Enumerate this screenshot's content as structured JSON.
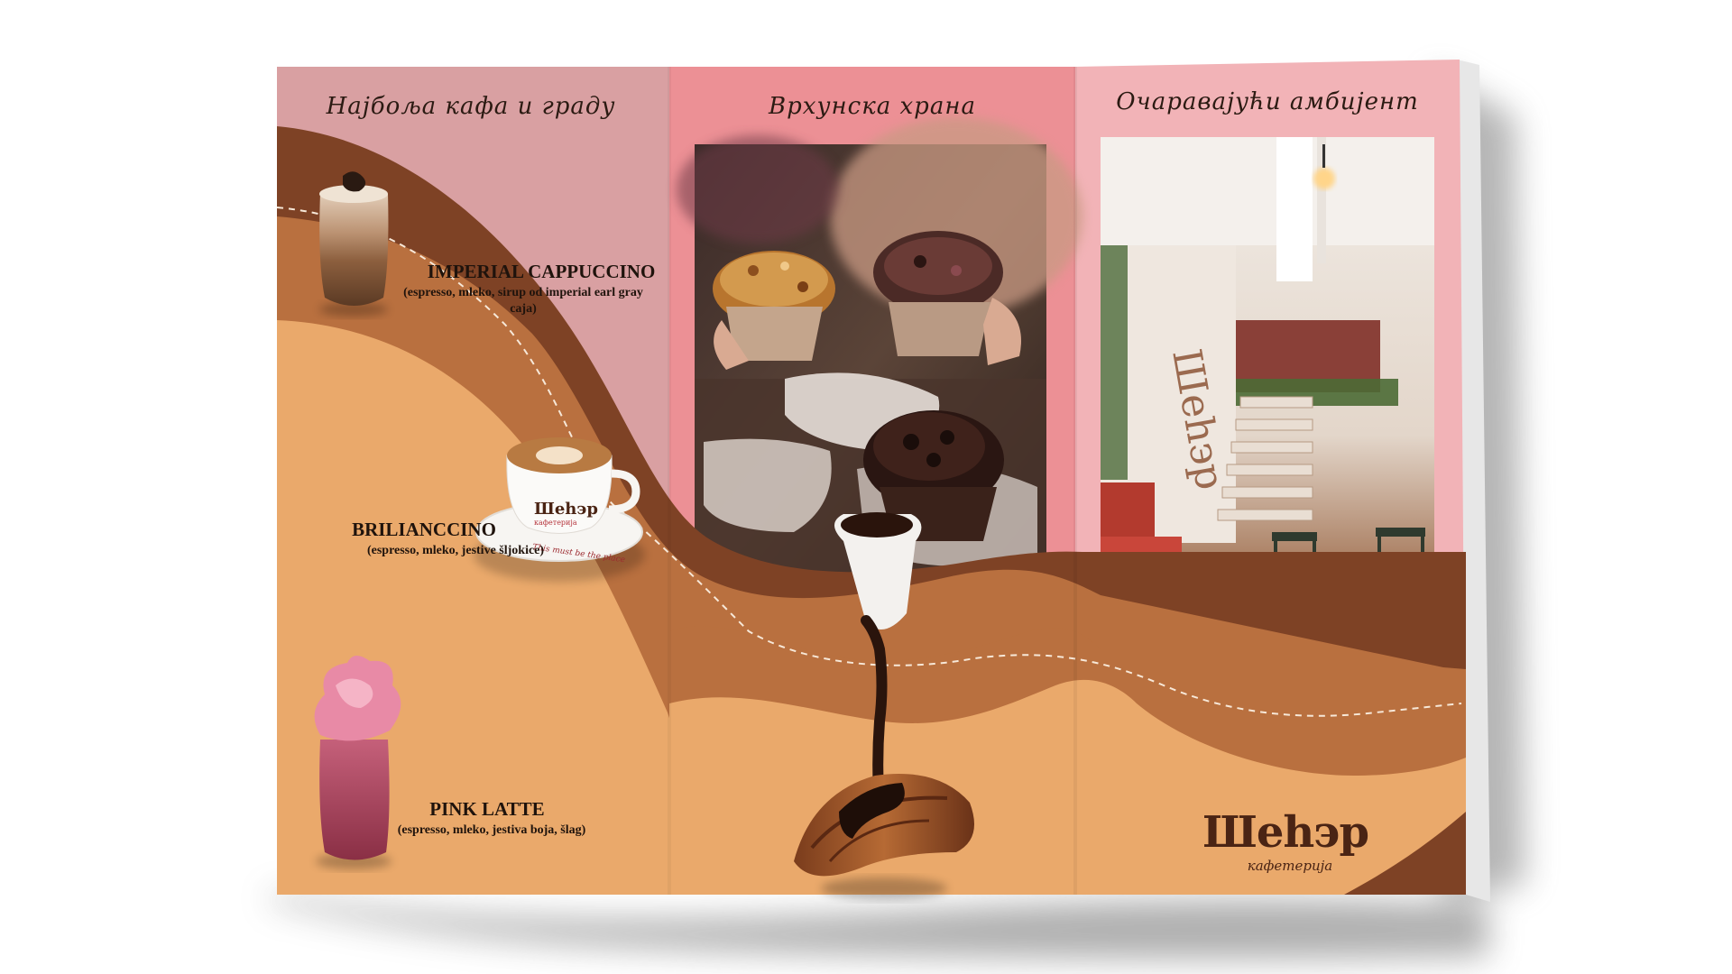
{
  "brochure": {
    "panels": {
      "left": {
        "title": "Најбоља кафа и граду"
      },
      "middle": {
        "title": "Врхунска храна"
      },
      "right": {
        "title": "Очаравајући амбијент"
      }
    },
    "coffees": [
      {
        "name": "IMPERIAL CAPPUCCINO",
        "description": "(espresso, mleko, sirup od imperial earl gray caja)"
      },
      {
        "name": "BRILIANCCINO",
        "description": "(espresso, mleko, jestive šljokice)"
      },
      {
        "name": "PINK LATTE",
        "description": "(espresso, mleko, jestiva boja, šlag)"
      }
    ],
    "cup_print": {
      "brand": "Шеһэр",
      "sub": "кафетерија",
      "saucer_script": "This must be the place"
    },
    "logo": {
      "brand": "Шеһэр",
      "sub": "кафетерија"
    }
  },
  "colors": {
    "pink_left": "#d9a0a2",
    "pink_middle": "#ec9095",
    "pink_right": "#f2b3b7",
    "wave_light": "#eaa96b",
    "wave_mid": "#b9703f",
    "wave_dark": "#7e4225",
    "text_dark": "#1f130c",
    "logo_brown": "#4a2414"
  }
}
